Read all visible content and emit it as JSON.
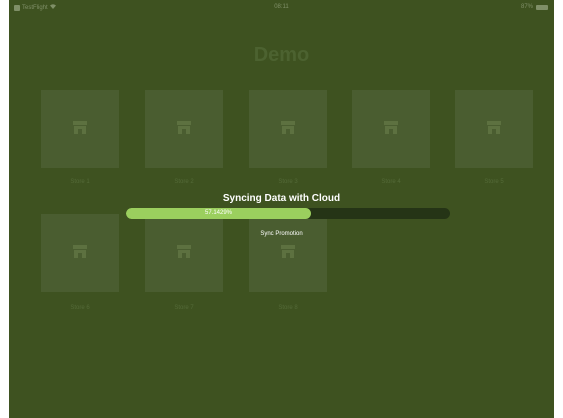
{
  "status_bar": {
    "app_name": "TestFlight",
    "time": "08:11",
    "battery": "87%"
  },
  "page": {
    "title": "Demo"
  },
  "tiles": [
    {
      "label": "Store 1"
    },
    {
      "label": "Store 2"
    },
    {
      "label": "Store 3"
    },
    {
      "label": "Store 4"
    },
    {
      "label": "Store 5"
    },
    {
      "label": "Store 6"
    },
    {
      "label": "Store 7"
    },
    {
      "label": "Store 8"
    }
  ],
  "sync_overlay": {
    "title": "Syncing Data with Cloud",
    "progress_percent": 57.1429,
    "progress_text": "57.1429%",
    "subtitle": "Sync Promotion"
  },
  "colors": {
    "background": "#3e5220",
    "tile": "#4a5d30",
    "progress_fill": "#9bcf5e",
    "progress_track": "#253416"
  }
}
